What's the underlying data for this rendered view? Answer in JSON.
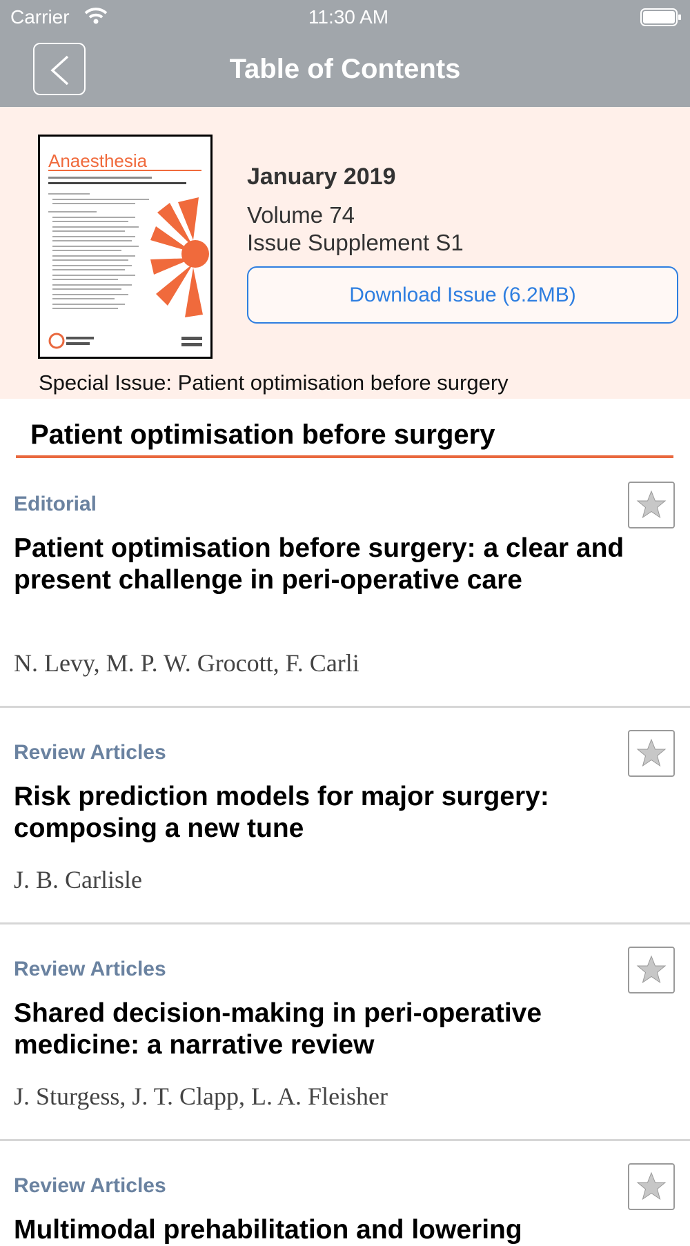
{
  "status_bar": {
    "carrier": "Carrier",
    "time": "11:30 AM"
  },
  "nav": {
    "title": "Table of Contents"
  },
  "issue": {
    "cover_journal": "Anaesthesia",
    "date": "January 2019",
    "volume": "Volume 74",
    "supplement": "Issue Supplement S1",
    "download_label": "Download Issue (6.2MB)",
    "special_issue": "Special Issue: Patient optimisation before surgery"
  },
  "section": {
    "title": "Patient optimisation before surgery"
  },
  "articles": [
    {
      "type": "Editorial",
      "title": "Patient optimisation before surgery: a clear and present challenge in peri-operative care",
      "authors": "N. Levy, M. P. W. Grocott, F. Carli"
    },
    {
      "type": "Review Articles",
      "title": "Risk prediction models for major surgery: composing a new tune",
      "authors": "J. B. Carlisle"
    },
    {
      "type": "Review Articles",
      "title": "Shared decision-making in peri-operative medicine: a narrative review",
      "authors": "J. Sturgess, J. T. Clapp, L. A. Fleisher"
    },
    {
      "type": "Review Articles",
      "title": "Multimodal prehabilitation and lowering",
      "authors": ""
    }
  ],
  "colors": {
    "nav_background": "#a1a6ab",
    "header_background": "#fff0ea",
    "accent": "#e9683e",
    "link": "#2e7ee0",
    "article_type": "#6a82a0"
  }
}
